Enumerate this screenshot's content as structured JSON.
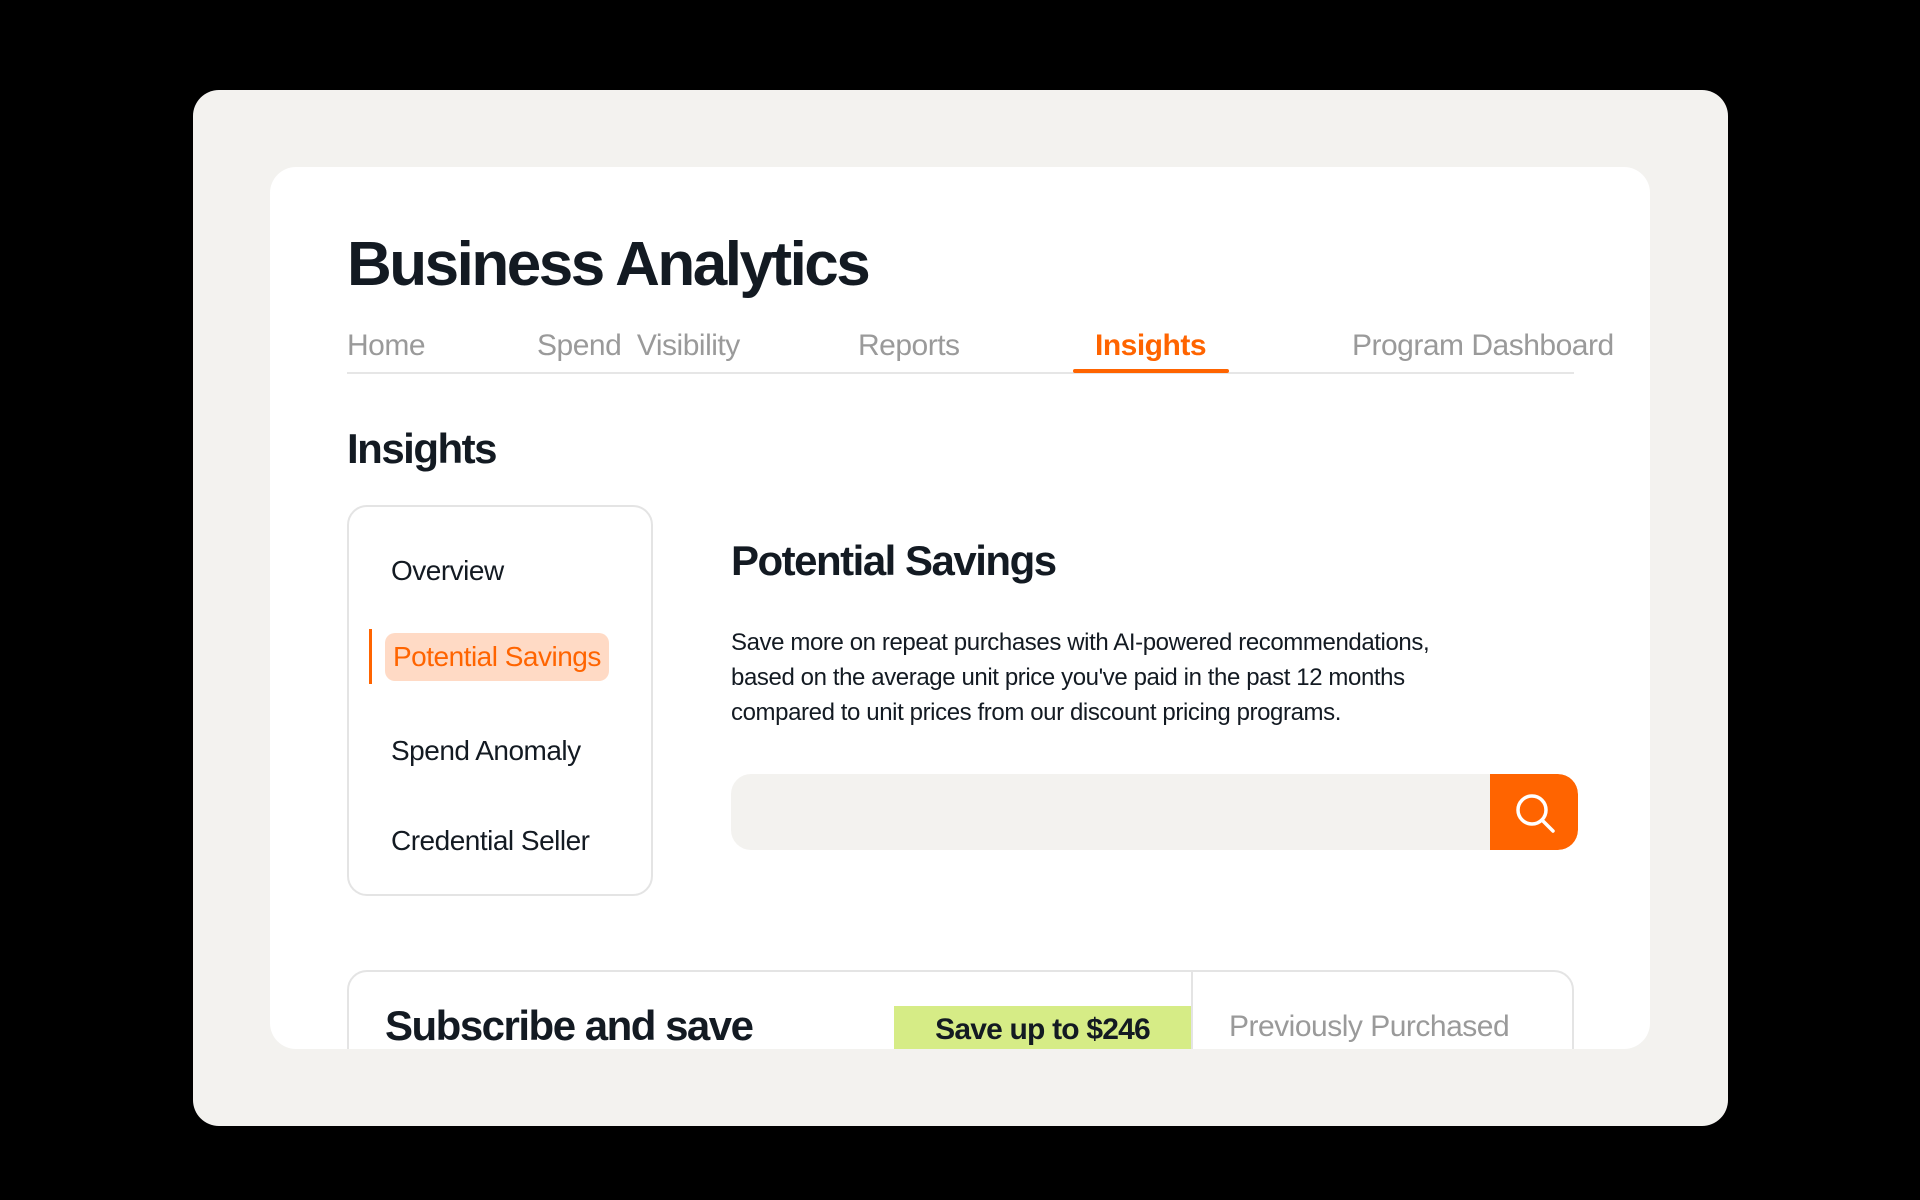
{
  "app": {
    "title": "Business Analytics"
  },
  "tabs": [
    {
      "label": "Home",
      "active": false
    },
    {
      "label": "Spend  Visibility",
      "active": false
    },
    {
      "label": "Reports",
      "active": false
    },
    {
      "label": "Insights",
      "active": true
    },
    {
      "label": "Program Dashboard",
      "active": false
    }
  ],
  "section": {
    "title": "Insights"
  },
  "sidebar": {
    "items": [
      {
        "label": "Overview",
        "active": false
      },
      {
        "label": "Potential Savings",
        "active": true
      },
      {
        "label": "Spend Anomaly",
        "active": false
      },
      {
        "label": "Credential Seller",
        "active": false
      }
    ]
  },
  "main": {
    "heading": "Potential Savings",
    "description": "Save more on repeat purchases with AI-powered recommendations, based on the average unit price you've paid in the past 12 months compared to unit prices from our discount pricing programs.",
    "search": {
      "value": "",
      "placeholder": "",
      "button_icon": "search-icon"
    }
  },
  "subscribe_card": {
    "title": "Subscribe and save",
    "badge": "Save up to $246",
    "tab": "Previously Purchased"
  },
  "colors": {
    "accent": "#ff6400",
    "accent_light": "#ffdac5",
    "badge_green": "#d6ec86",
    "frame_bg": "#f3f2ef",
    "text_dark": "#131a22",
    "text_muted": "#9a9a9a"
  }
}
